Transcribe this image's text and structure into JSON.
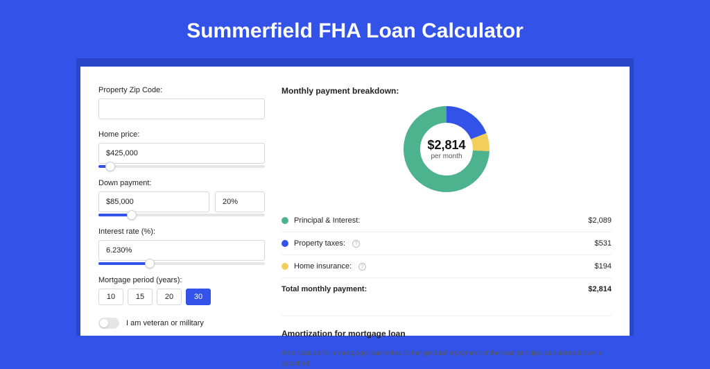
{
  "title": "Summerfield FHA Loan Calculator",
  "form": {
    "zip_label": "Property Zip Code:",
    "zip_value": "",
    "home_price_label": "Home price:",
    "home_price_value": "$425,000",
    "home_price_slider_pct": 7,
    "down_payment_label": "Down payment:",
    "down_payment_value": "$85,000",
    "down_payment_pct": "20%",
    "down_payment_slider_pct": 20,
    "interest_label": "Interest rate (%):",
    "interest_value": "6.230%",
    "interest_slider_pct": 31,
    "period_label": "Mortgage period (years):",
    "periods": [
      "10",
      "15",
      "20",
      "30"
    ],
    "period_selected": "30",
    "veteran_label": "I am veteran or military",
    "veteran_on": false
  },
  "breakdown": {
    "title": "Monthly payment breakdown:",
    "total_display": "$2,814",
    "sub": "per month",
    "items": [
      {
        "label": "Principal & Interest:",
        "value": "$2,089",
        "color": "green",
        "info": false
      },
      {
        "label": "Property taxes:",
        "value": "$531",
        "color": "blue",
        "info": true
      },
      {
        "label": "Home insurance:",
        "value": "$194",
        "color": "yellow",
        "info": true
      }
    ],
    "total_label": "Total monthly payment:",
    "total_value": "$2,814"
  },
  "chart_data": {
    "type": "pie",
    "title": "Monthly payment breakdown",
    "series": [
      {
        "name": "Principal & Interest",
        "value": 2089,
        "color": "#4db28e"
      },
      {
        "name": "Property taxes",
        "value": 531,
        "color": "#3353e8"
      },
      {
        "name": "Home insurance",
        "value": 194,
        "color": "#f2cf5b"
      }
    ],
    "total": 2814
  },
  "amortization": {
    "title": "Amortization for mortgage loan",
    "body": "Amortization for a mortgage loan refers to the gradual repayment of the loan principal and interest over a specified"
  },
  "colors": {
    "primary": "#3353e8",
    "green": "#4db28e",
    "yellow": "#f2cf5b"
  }
}
